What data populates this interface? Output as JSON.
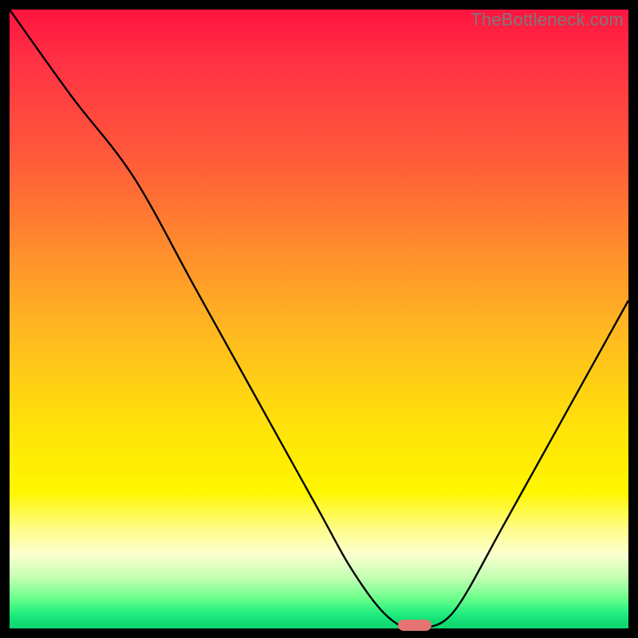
{
  "watermark": "TheBottleneck.com",
  "chart_data": {
    "type": "line",
    "title": "",
    "xlabel": "",
    "ylabel": "",
    "xlim": [
      0,
      100
    ],
    "ylim": [
      0,
      100
    ],
    "grid": false,
    "series": [
      {
        "name": "bottleneck-curve",
        "x": [
          0,
          10,
          20,
          30,
          40,
          50,
          55,
          60,
          64,
          67,
          72,
          80,
          90,
          100
        ],
        "y": [
          100,
          86,
          73,
          55,
          37,
          19,
          10,
          3,
          0,
          0,
          3,
          17,
          35,
          53
        ]
      }
    ],
    "marker": {
      "x": 65.5,
      "y": 0.5,
      "color": "#e57373"
    },
    "background_gradient": {
      "top": "#ff143e",
      "bottom": "#0fd571"
    }
  }
}
